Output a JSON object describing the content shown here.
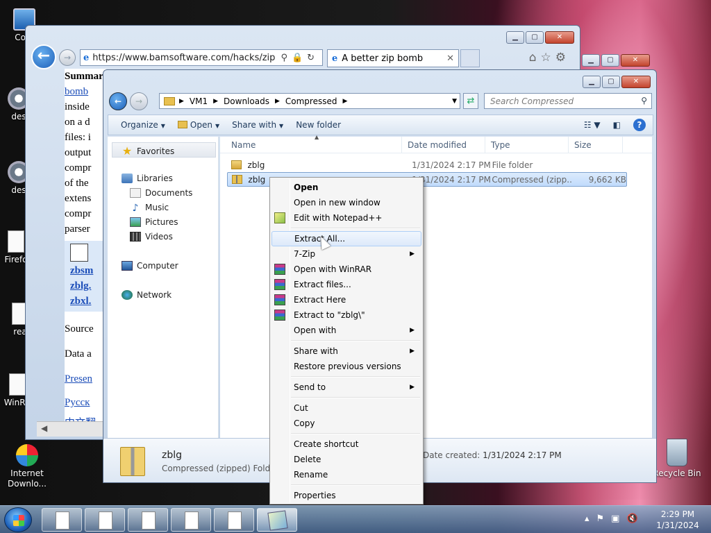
{
  "desktop": {
    "icons": [
      {
        "label": "Com",
        "icon": "computer-icon"
      },
      {
        "label": "des",
        "icon": "gear-icon"
      },
      {
        "label": "des",
        "icon": "gear-icon"
      },
      {
        "label": "Firefo",
        "icon": "document-icon"
      },
      {
        "label": "rea",
        "icon": "document-icon"
      },
      {
        "label": "WinRA",
        "icon": "document-icon"
      },
      {
        "label": "Internet Downlo...",
        "icon": "idm-icon"
      },
      {
        "label": "Recycle Bin",
        "icon": "recycle-bin-icon"
      }
    ]
  },
  "browser": {
    "url": "https://www.bamsoftware.com/hacks/zip",
    "tab_title": "A better zip bomb",
    "content_lines": [
      "Summary",
      "bomb",
      "inside",
      "on a d",
      "files: i",
      "output",
      "compr",
      "of the",
      "extens",
      "compr",
      "parser"
    ],
    "file_links": [
      "zbsm",
      "zblg.",
      "zbxl."
    ],
    "lower_lines": [
      "Source",
      "Data a"
    ],
    "lower_links": [
      "Presen",
      "Русск",
      "中文翻"
    ]
  },
  "explorer": {
    "breadcrumb": [
      "VM1",
      "Downloads",
      "Compressed"
    ],
    "search_placeholder": "Search Compressed",
    "toolbar": {
      "organize": "Organize",
      "open": "Open",
      "share_with": "Share with",
      "new_folder": "New folder"
    },
    "nav": {
      "favorites": "Favorites",
      "libraries": "Libraries",
      "documents": "Documents",
      "music": "Music",
      "pictures": "Pictures",
      "videos": "Videos",
      "computer": "Computer",
      "network": "Network"
    },
    "columns": {
      "name": "Name",
      "date": "Date modified",
      "type": "Type",
      "size": "Size"
    },
    "files": [
      {
        "name": "zblg",
        "date": "1/31/2024 2:17 PM",
        "type": "File folder",
        "size": ""
      },
      {
        "name": "zblg",
        "date": "1/31/2024 2:17 PM",
        "type": "Compressed (zipp...",
        "size": "9,662 KB"
      }
    ],
    "details": {
      "name": "zblg",
      "type": "Compressed (zipped) Folder",
      "created_label": "Date created:",
      "created_value": "1/31/2024 2:17 PM"
    }
  },
  "context_menu": {
    "items": [
      {
        "label": "Open"
      },
      {
        "label": "Open in new window"
      },
      {
        "label": "Edit with Notepad++"
      },
      {
        "label": "Extract All..."
      },
      {
        "label": "7-Zip"
      },
      {
        "label": "Open with WinRAR"
      },
      {
        "label": "Extract files..."
      },
      {
        "label": "Extract Here"
      },
      {
        "label": "Extract to \"zblg\\\""
      },
      {
        "label": "Open with"
      },
      {
        "label": "Share with"
      },
      {
        "label": "Restore previous versions"
      },
      {
        "label": "Send to"
      },
      {
        "label": "Cut"
      },
      {
        "label": "Copy"
      },
      {
        "label": "Create shortcut"
      },
      {
        "label": "Delete"
      },
      {
        "label": "Rename"
      },
      {
        "label": "Properties"
      }
    ]
  },
  "taskbar": {
    "time": "2:29 PM",
    "date": "1/31/2024"
  }
}
